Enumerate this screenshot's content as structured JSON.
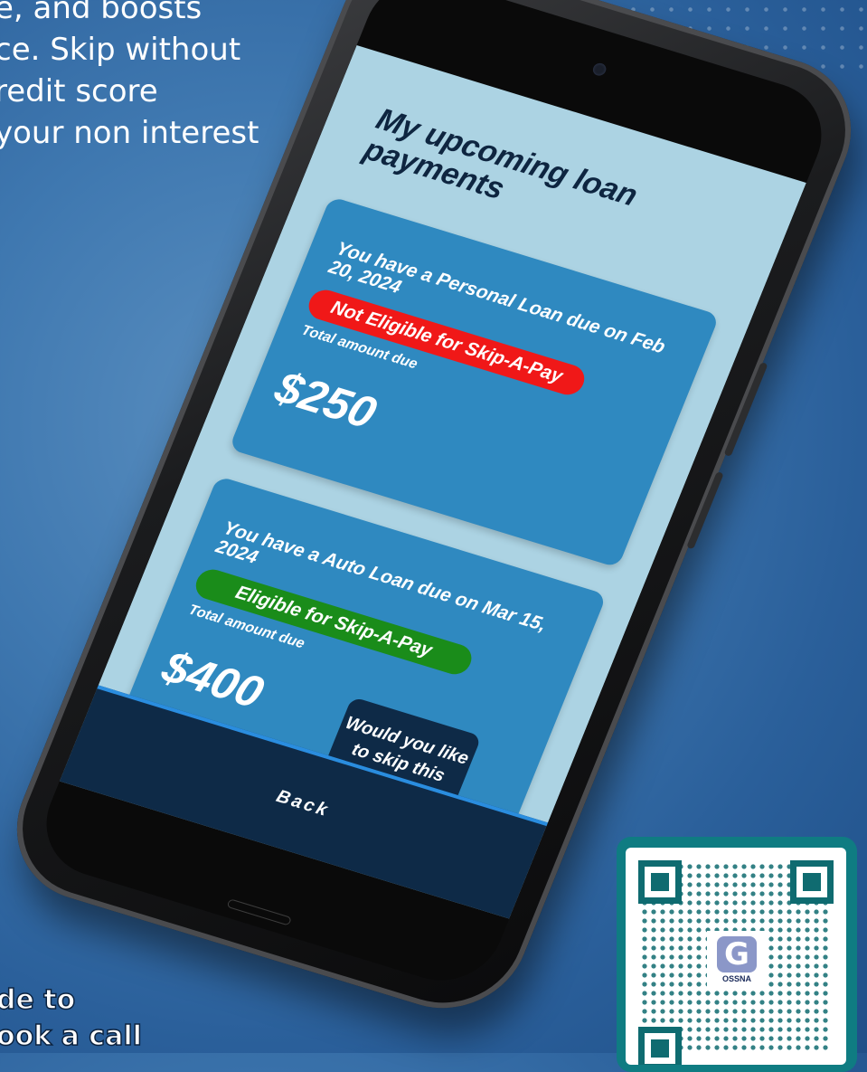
{
  "promo": {
    "text": "e, and boosts\nce. Skip without\nredit score\nyour non interest"
  },
  "cta": {
    "text": "de to\nook a call"
  },
  "app": {
    "title": "My upcoming loan payments",
    "loans": [
      {
        "description": "You have a Personal Loan due on Feb 20, 2024",
        "eligibility": "Not Eligible for Skip-A-Pay",
        "eligible": false,
        "amount_label": "Total amount due",
        "amount": "$250"
      },
      {
        "description": "You have a Auto Loan due on Mar 15, 2024",
        "eligibility": "Eligible for Skip-A-Pay",
        "eligible": true,
        "amount_label": "Total amount due",
        "amount": "$400",
        "skip_prompt": "Would you like to skip this payment?"
      }
    ],
    "back_label": "Back"
  },
  "qr": {
    "logo_text": "OSSNA",
    "logo_glyph": "G"
  },
  "colors": {
    "background": "#3f78b0",
    "screen": "#acd3e3",
    "card": "#2f89c0",
    "not_eligible": "#f01818",
    "eligible": "#1a8c1a",
    "dark_navy": "#0e2a47",
    "qr_frame": "#0f7c82"
  }
}
